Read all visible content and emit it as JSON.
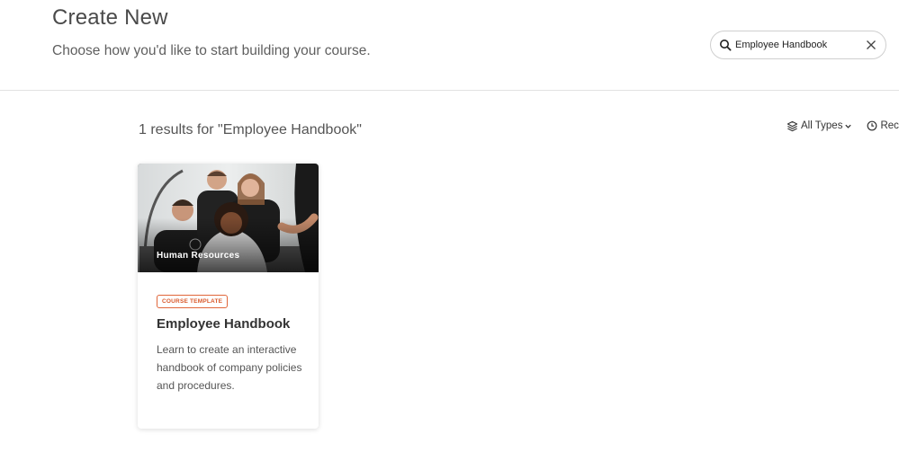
{
  "header": {
    "title": "Create New",
    "subtitle": "Choose how you'd like to start building your course."
  },
  "search": {
    "value": "Employee Handbook",
    "icon": "search-icon",
    "clear_icon": "close-icon"
  },
  "results": {
    "summary": "1 results for \"Employee Handbook\""
  },
  "filters": [
    {
      "label": "All Types",
      "icon": "layers-icon",
      "has_dropdown": true
    },
    {
      "label": "Rece",
      "icon": "clock-icon"
    }
  ],
  "cards": [
    {
      "category": "Human Resources",
      "badge": "COURSE TEMPLATE",
      "title": "Employee Handbook",
      "description": "Learn to create an interactive handbook of company policies and procedures."
    }
  ],
  "colors": {
    "badge_accent": "#e0663a",
    "divider": "#e2e2e2"
  }
}
